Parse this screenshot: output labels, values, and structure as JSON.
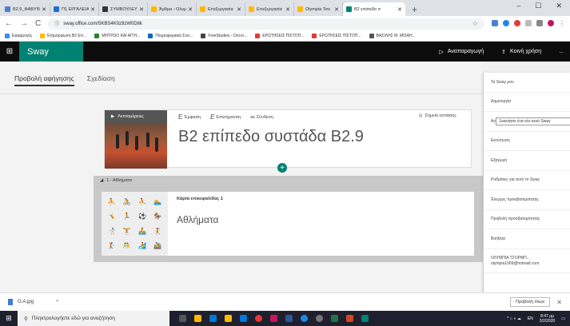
{
  "browser": {
    "tabs": [
      {
        "label": "B2,9_ΦΑΒΥΙ5",
        "color": "#4a7fd4"
      },
      {
        "label": "Π1 ΕΡΓΑΛΕΙΑ",
        "color": "#1e6fd9"
      },
      {
        "label": "ΣΥΜΒΟΥΛΕΥΤ",
        "color": "#333333"
      },
      {
        "label": "Άρθρα - Ολυμ",
        "color": "#ffb900"
      },
      {
        "label": "Επεξεργασία",
        "color": "#ffb900"
      },
      {
        "label": "Επεξεργασία",
        "color": "#ffb900"
      },
      {
        "label": "Olympia Τσο",
        "color": "#ffb900"
      },
      {
        "label": "B2 επίπεδο σ",
        "color": "#008272",
        "active": true
      }
    ],
    "new_tab": "+",
    "url": "sway.office.com/5KBS4K0z9zW0Dtlk",
    "bookmarks": [
      {
        "label": "Εφαρμογές",
        "color": "#4285f4"
      },
      {
        "label": "Επιμόρφωση Β2 Επ...",
        "color": "#ffb900"
      },
      {
        "label": "ΜΗΤΡΩΟ ΚΑΙ ΑΙΤΗ...",
        "color": "#2e7d32"
      },
      {
        "label": "Πληροφοριακό Σύσ...",
        "color": "#1565c0"
      },
      {
        "label": "FreeStudies - OnLin...",
        "color": "#444444"
      },
      {
        "label": "ΕΡΩΤΗΣΕΙΣ ΠΙΣΤΟΠ...",
        "color": "#e53935"
      },
      {
        "label": "ΕΡΩΤΗΣΕΙΣ ΠΙΣΤΟΠ...",
        "color": "#e53935"
      },
      {
        "label": "ΒΑΣΙΛΗΣ Μ. ΜΙΣΑΗ...",
        "color": "#555555"
      }
    ]
  },
  "app": {
    "brand": "Sway",
    "brand_color": "#008272",
    "play_label": "Αναπαραγωγή",
    "share_label": "Κοινή χρήση",
    "more_label": "..."
  },
  "view_tabs": [
    "Προβολή αφήγησης",
    "Σχεδίαση"
  ],
  "title_card": {
    "details_label": "Λεπτομέρειες",
    "toolbar": [
      {
        "glyph": "E",
        "label": "Έμφαση"
      },
      {
        "glyph": "E",
        "label": "Επισήμανση"
      },
      {
        "glyph": "∞",
        "label": "Σύνδεση"
      }
    ],
    "focus_label": "Σημεία εστίασης",
    "title": "B2 επίπεδο συστάδα B2.9"
  },
  "group": {
    "header": "1 - Αθλήματα",
    "card_heading": "Κάρτα επικεφαλίδας 1",
    "card_title": "Αθλήματα"
  },
  "menu": {
    "items": [
      "Τα Sway μου",
      "Δημιουργία",
      "Αναπαραγωγή αυτού του Sway",
      "Εκτύπωση",
      "Εξαγωγή",
      "Ρυθμίσεις για αυτό το Sway",
      "Έλεγχος προσβασιμότητας",
      "Προβολή προσβασιμότητας",
      "Βοήθεια"
    ],
    "account_name": "ΟΛΥΜΠΙΑ ΤΣΟΡΜΠ...",
    "account_email": "olympia1009@hotmail.com",
    "tooltip": "Ξεκινήστε ένα νέο κενό Sway"
  },
  "downloads": {
    "file": "O.A.jpg",
    "show_all": "Προβολή όλων",
    "close": "✕"
  },
  "taskbar": {
    "search_placeholder": "Πληκτρολογήστε εδώ για αναζήτηση",
    "lang": "EN",
    "time": "8:47 μμ",
    "date": "3/2/2020"
  }
}
